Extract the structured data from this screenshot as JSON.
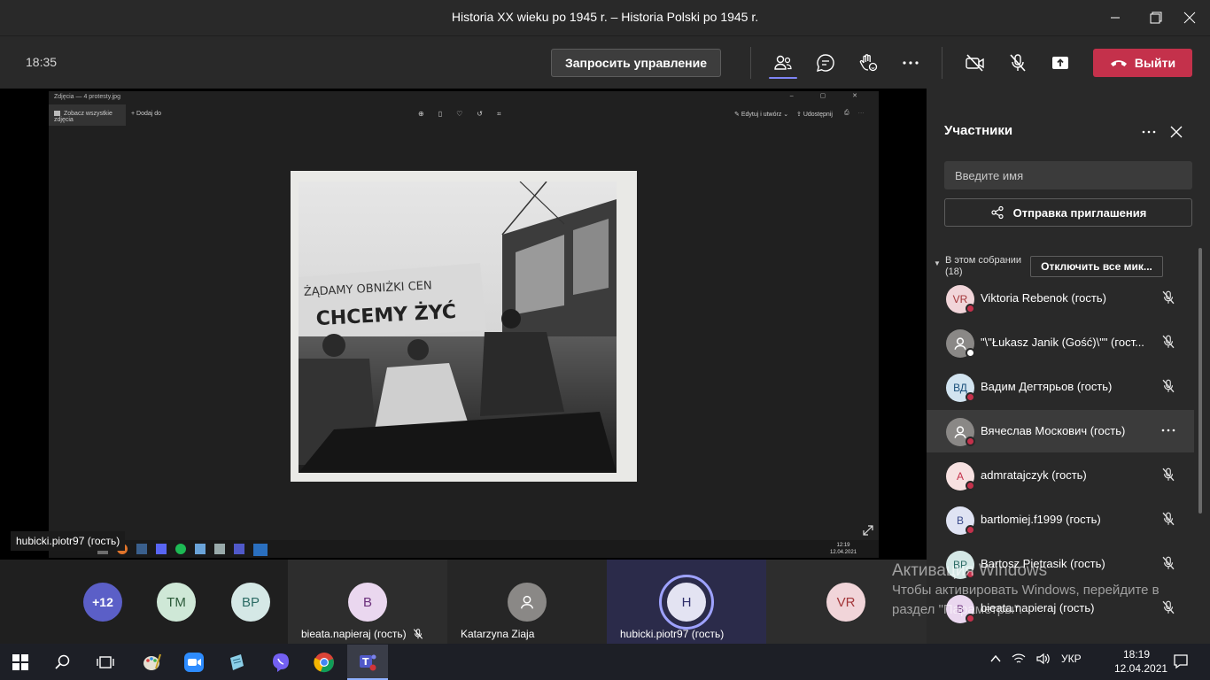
{
  "window": {
    "title": "Historia XX wieku po 1945 r. – Historia Polski po 1945 r."
  },
  "toolbar": {
    "clock": "18:35",
    "request_control_label": "Запросить управление",
    "leave_label": "Выйти"
  },
  "shared_screen": {
    "app_title": "Zdjęcia — 4 protesty.jpg",
    "see_all_label": "Zobacz wszystkie zdjęcia",
    "add_label": "Dodaj do",
    "edit_label": "Edytuj i utwórz",
    "share_label": "Udostępnij",
    "photo_banner_line1": "ŻĄDAMY OBNIŻKI CEN",
    "photo_banner_line2": "CHCEMY ŻYĆ",
    "inner_clock_time": "12:19",
    "inner_clock_date": "12.04.2021",
    "presenter_label": "hubicki.piotr97 (гость)"
  },
  "panel": {
    "title": "Участники",
    "search_placeholder": "Введите имя",
    "invite_label": "Отправка приглашения",
    "section_label": "В этом собрании (18)",
    "mute_all_label": "Отключить все мик...",
    "participants": [
      {
        "initials": "VR",
        "name": "Viktoria Rebenok (гость)",
        "color": "#f1d5d9",
        "fg": "#a4373a",
        "status": "busy"
      },
      {
        "initials": "",
        "name": "\"\\\"Łukasz Janik (Gość)\\\"\" (гост...",
        "color": "#8a8886",
        "fg": "#fff",
        "status": "away"
      },
      {
        "initials": "ВД",
        "name": "Вадим Дегтярьов (гость)",
        "color": "#d2e4f0",
        "fg": "#1a4f7a",
        "status": "busy"
      },
      {
        "initials": "",
        "name": "Вячеслав Москович (гость)",
        "color": "#8a8886",
        "fg": "#fff",
        "status": "busy"
      },
      {
        "initials": "A",
        "name": "admratajczyk (гость)",
        "color": "#f7e1e1",
        "fg": "#c4314b",
        "status": "busy"
      },
      {
        "initials": "B",
        "name": "bartlomiej.f1999 (гость)",
        "color": "#dfe3f3",
        "fg": "#3a4a8a",
        "status": "busy"
      },
      {
        "initials": "BP",
        "name": "Bartosz Pietrasik (гость)",
        "color": "#d5e8e6",
        "fg": "#2c6b65",
        "status": "busy"
      },
      {
        "initials": "B",
        "name": "bieata.napieraj (гость)",
        "color": "#ead7ef",
        "fg": "#6b2f7b",
        "status": "busy"
      }
    ]
  },
  "gallery": {
    "overflow_count": "+12",
    "avatars": [
      {
        "initials": "TM",
        "color": "#cfe8d7",
        "fg": "#2c5b3a"
      },
      {
        "initials": "BP",
        "color": "#d5e8e6",
        "fg": "#2c6b65"
      }
    ],
    "tiles": [
      {
        "initials": "B",
        "name": "bieata.napieraj (гость)",
        "color": "#ead7ef",
        "fg": "#6b2f7b"
      },
      {
        "initials": "",
        "name": "Katarzyna Ziaja",
        "color": "#8a8886",
        "fg": "#fff"
      },
      {
        "initials": "H",
        "name": "hubicki.piotr97 (гость)",
        "color": "#e3e3f2",
        "fg": "#2f2f6a"
      },
      {
        "initials": "VR",
        "name": "",
        "color": "#f1d5d9",
        "fg": "#a4373a"
      }
    ]
  },
  "watermark": {
    "line1": "Активация Windows",
    "line2": "Чтобы активировать Windows, перейдите в",
    "line3": "раздел \"Параметры\"."
  },
  "taskbar": {
    "lang": "УКР",
    "time": "18:19",
    "date": "12.04.2021",
    "apps": [
      "windows-start",
      "search",
      "task-view",
      "paint",
      "zoom",
      "notepad",
      "viber",
      "chrome",
      "teams"
    ]
  }
}
